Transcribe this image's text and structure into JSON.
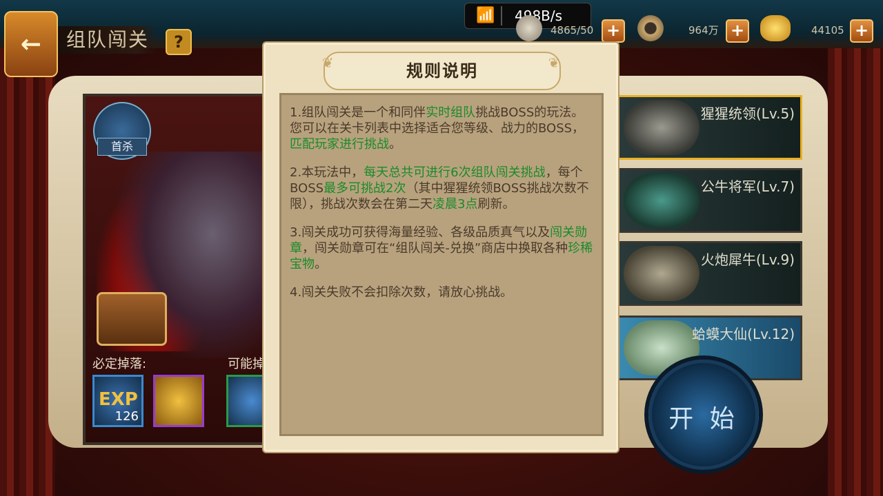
{
  "status": {
    "wifi_icon": "wifi-icon",
    "net_speed": "498B/s"
  },
  "header": {
    "title": "组队闯关",
    "help_label": "?",
    "back_icon": "←",
    "stamina": "4865/50",
    "coins": "964万",
    "gold": "44105",
    "plus_label": "+"
  },
  "left": {
    "first_kill_label": "首杀",
    "guaranteed_drop_label": "必定掉落:",
    "possible_drop_label": "可能掉",
    "exp_label": "EXP",
    "exp_amount": "126"
  },
  "boss_list": [
    {
      "name": "猩猩统领(Lv.5)",
      "selected": true
    },
    {
      "name": "公牛将军(Lv.7)",
      "selected": false
    },
    {
      "name": "火炮犀牛(Lv.9)",
      "selected": false
    },
    {
      "name": "蛤蟆大仙(Lv.12)",
      "selected": false
    }
  ],
  "start_button": "开 始",
  "dialog": {
    "title": "规则说明",
    "rule1": {
      "a": "1.组队闯关是一个和同伴",
      "b": "实时组队",
      "c": "挑战BOSS的玩法。您可以在关卡列表中选择适合您等级、战力的BOSS，",
      "d": "匹配玩家进行挑战",
      "e": "。"
    },
    "rule2": {
      "a": "2.本玩法中，",
      "b": "每天总共可进行6次组队闯关挑战",
      "c": "，每个BOSS",
      "d": "最多可挑战2次",
      "e": "（其中猩猩统领BOSS挑战次数不限），挑战次数会在第二天",
      "f": "凌晨3点",
      "g": "刷新。"
    },
    "rule3": {
      "a": "3.闯关成功可获得海量经验、各级品质真气以及",
      "b": "闯关勋章",
      "c": "，闯关勋章可在“组队闯关-兑换”商店中换取各种",
      "d": "珍稀宝物",
      "e": "。"
    },
    "rule4": "4.闯关失败不会扣除次数，请放心挑战。"
  },
  "colors": {
    "highlight": "#1a8a2a",
    "text": "#4a3a2a",
    "selected_border": "#e8b020"
  }
}
